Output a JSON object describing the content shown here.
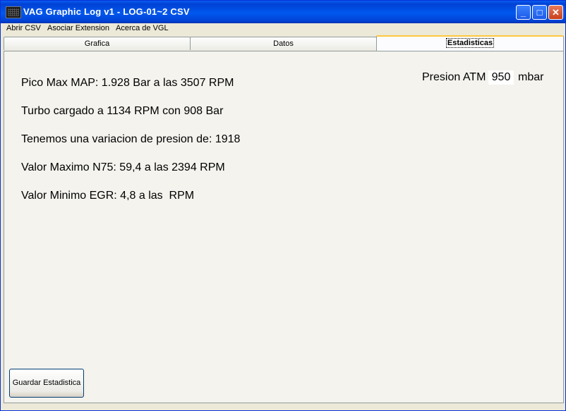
{
  "window": {
    "title": "VAG Graphic Log  v1  -  LOG-01~2 CSV"
  },
  "title_buttons": {
    "minimize": "_",
    "maximize": "□",
    "close": "✕"
  },
  "menu": {
    "items": [
      "Abrir CSV",
      "Asociar Extension",
      "Acerca de VGL"
    ]
  },
  "tabs": [
    {
      "label": "Grafica",
      "active": false
    },
    {
      "label": "Datos",
      "active": false
    },
    {
      "label": "Estadisticas",
      "active": true
    }
  ],
  "stats": {
    "line1": "Pico Max MAP: 1.928 Bar a las 3507 RPM",
    "line2": "Turbo cargado a 1134 RPM con 908 Bar",
    "line3": "Tenemos una variacion de presion de: 1918",
    "line4": "Valor Maximo N75: 59,4 a las 2394 RPM",
    "line5": "Valor Minimo EGR: 4,8 a las  RPM"
  },
  "atm": {
    "label": "Presion ATM",
    "value": "950",
    "unit": "mbar"
  },
  "buttons": {
    "save": "Guardar  Estadistica"
  },
  "colors": {
    "titlebar": "#0054e3",
    "panel": "#f4f3ee",
    "accent_tab": "#ffc73c"
  }
}
